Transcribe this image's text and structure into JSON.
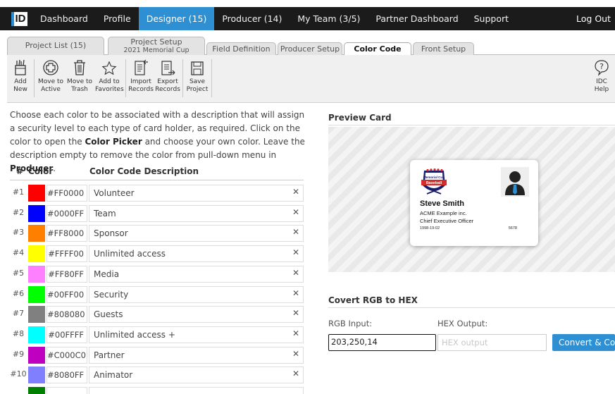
{
  "nav": {
    "logo": "ID",
    "items": [
      {
        "label": "Dashboard",
        "active": false
      },
      {
        "label": "Profile",
        "active": false
      },
      {
        "label": "Designer (15)",
        "active": true
      },
      {
        "label": "Producer (14)",
        "active": false
      },
      {
        "label": "My Team (3/5)",
        "active": false
      },
      {
        "label": "Partner Dashboard",
        "active": false
      },
      {
        "label": "Support",
        "active": false
      }
    ],
    "logout": "Log Out"
  },
  "tabs": {
    "project_list": "Project List (15)",
    "project_setup_line1": "Project Setup",
    "project_setup_line2": "2021 Memorial Cup",
    "field_definition": "Field Definition",
    "producer_setup": "Producer Setup",
    "color_code": "Color Code",
    "front_setup": "Front Setup"
  },
  "toolbar": {
    "add_new": [
      "Add",
      "New"
    ],
    "move_active": [
      "Move to",
      "Active"
    ],
    "move_trash": [
      "Move to",
      "Trash"
    ],
    "add_favorites": [
      "Add to",
      "Favorites"
    ],
    "import_records": [
      "Import",
      "Records"
    ],
    "export_records": [
      "Export",
      "Records"
    ],
    "save_project": [
      "Save",
      "Project"
    ],
    "idc_help": [
      "IDC",
      "Help"
    ]
  },
  "instructions": {
    "part1": "Choose each color to be associated with a description that will assign a security level to each type of card holder, as required. Click on the color to open the ",
    "bold1": "Color Picker",
    "part2": " and choose your own color. Leave the description empty to remove the color from pull-down menu in ",
    "bold2": "Producer",
    "part3": "."
  },
  "table": {
    "headers": {
      "num": "#",
      "color": "Color",
      "description": "Color Code Description"
    },
    "clear_glyph": "✕",
    "rows": [
      {
        "num": "#1",
        "hex": "#FF0000",
        "color": "#FF0000",
        "description": "Volunteer"
      },
      {
        "num": "#2",
        "hex": "#0000FF",
        "color": "#0000FF",
        "description": "Team"
      },
      {
        "num": "#3",
        "hex": "#FF8000",
        "color": "#FF8000",
        "description": "Sponsor"
      },
      {
        "num": "#4",
        "hex": "#FFFF00",
        "color": "#FFFF00",
        "description": "Unlimited access"
      },
      {
        "num": "#5",
        "hex": "#FF80FF",
        "color": "#FF80FF",
        "description": "Media"
      },
      {
        "num": "#6",
        "hex": "#00FF00",
        "color": "#00FF00",
        "description": "Security"
      },
      {
        "num": "#7",
        "hex": "#808080",
        "color": "#808080",
        "description": "Guests"
      },
      {
        "num": "#8",
        "hex": "#00FFFF",
        "color": "#00FFFF",
        "description": "Unlimited access +"
      },
      {
        "num": "#9",
        "hex": "#C000C0",
        "color": "#C000C0",
        "description": "Partner"
      },
      {
        "num": "#10",
        "hex": "#8080FF",
        "color": "#8080FF",
        "description": "Animator"
      },
      {
        "num": "",
        "hex": "",
        "color": "#008000",
        "description": ""
      }
    ]
  },
  "preview": {
    "title": "Preview Card",
    "card": {
      "name": "Steve Smith",
      "company": "ACME Example inc.",
      "job_title": "Chief Executive Officer",
      "date": "1998-19-02",
      "number": "5678",
      "logo_top": "Memorial Cup",
      "logo_banner": "Baseball"
    }
  },
  "converter": {
    "title": "Covert RGB to HEX",
    "rgb_label": "RGB Input:",
    "hex_label": "HEX Output:",
    "rgb_value": "203,250,14",
    "hex_placeholder": "HEX output",
    "button": "Convert & Copy"
  },
  "colors": {
    "accent": "#2F8FD3",
    "nav_bg": "#1B1B1B"
  }
}
